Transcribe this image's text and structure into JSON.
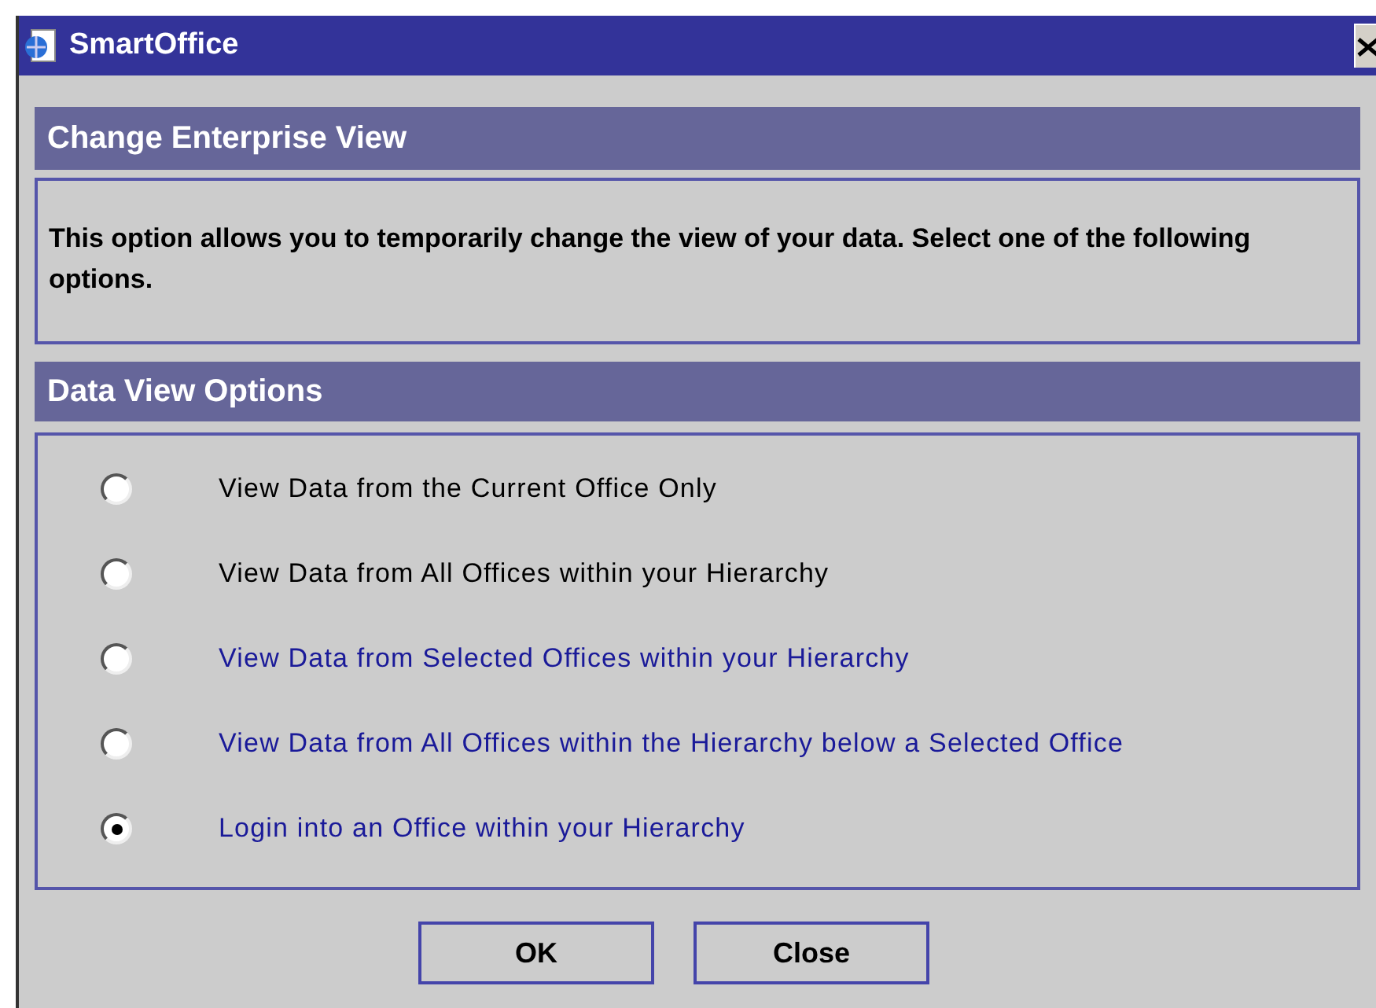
{
  "window": {
    "title": "SmartOffice"
  },
  "intro": {
    "title": "Change Enterprise View",
    "text": "This option allows you to temporarily change the view of your data. Select one of the following options."
  },
  "options_section": {
    "title": "Data View Options",
    "options": [
      {
        "label": "View Data from the Current Office Only",
        "selected": false,
        "color": "#000000"
      },
      {
        "label": "View Data from All Offices within your Hierarchy",
        "selected": false,
        "color": "#000000"
      },
      {
        "label": "View Data from Selected Offices within your Hierarchy",
        "selected": false,
        "color": "#1a1a99"
      },
      {
        "label": "View Data from All Offices within the Hierarchy below a Selected Office",
        "selected": false,
        "color": "#1a1a99"
      },
      {
        "label": "Login into an Office within your Hierarchy",
        "selected": true,
        "color": "#1a1a99"
      }
    ]
  },
  "buttons": [
    "OK",
    "Close"
  ]
}
